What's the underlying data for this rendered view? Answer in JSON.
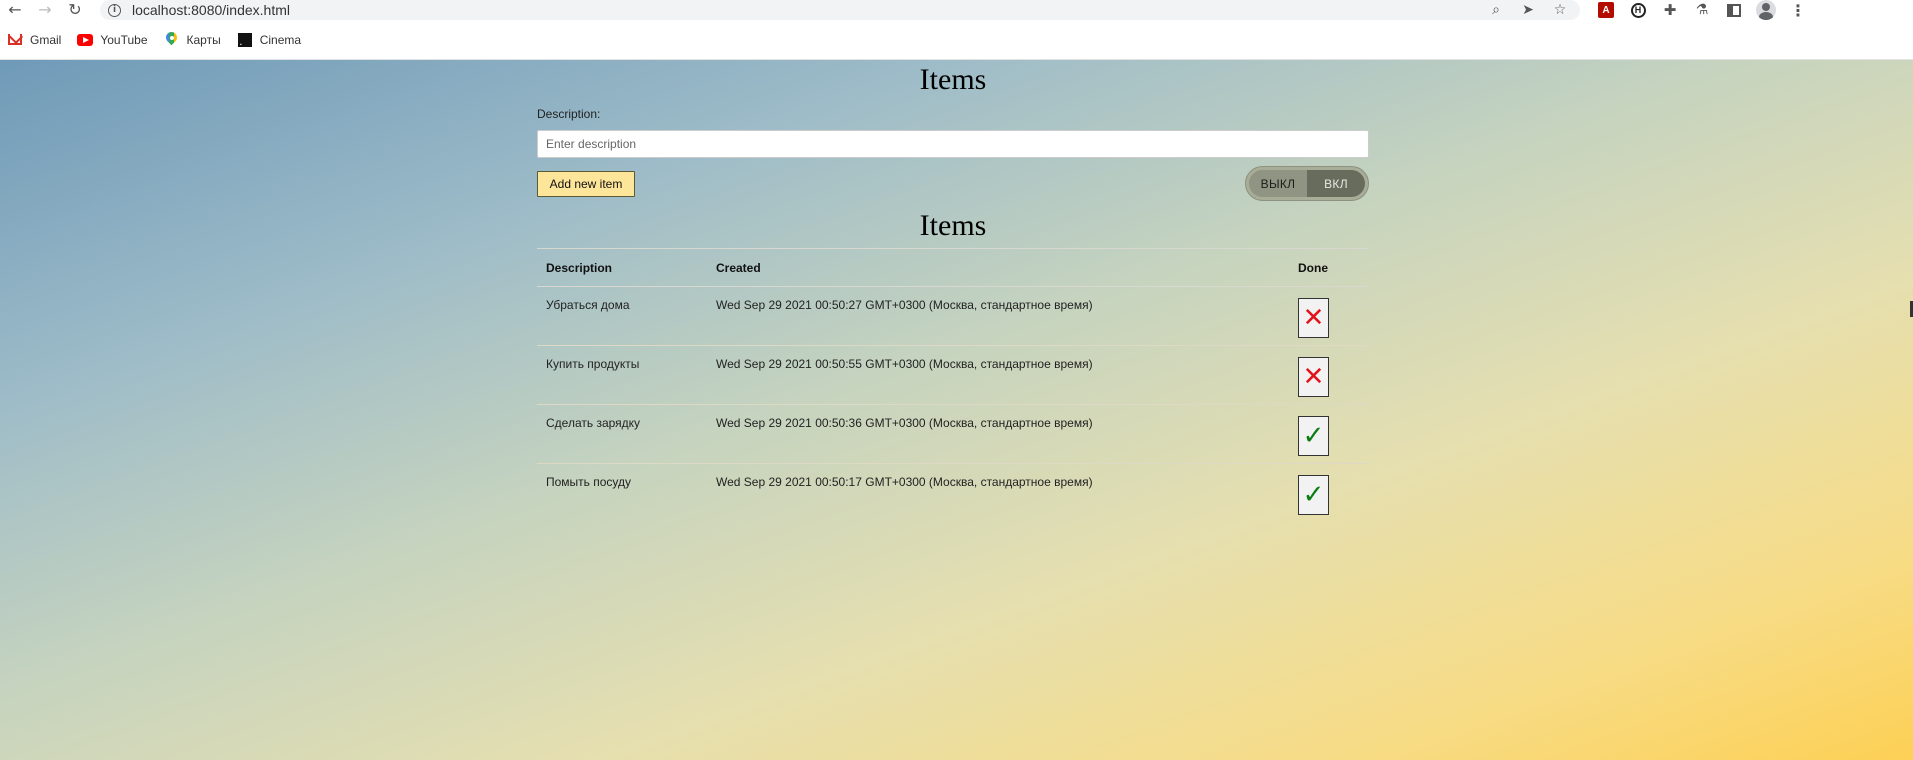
{
  "browser": {
    "url": "localhost:8080/index.html",
    "bookmarks": [
      {
        "label": "Gmail"
      },
      {
        "label": "YouTube"
      },
      {
        "label": "Карты"
      },
      {
        "label": "Cinema"
      }
    ]
  },
  "form": {
    "title": "Items",
    "description_label": "Description:",
    "description_placeholder": "Enter description",
    "description_value": "",
    "add_button_label": "Add new item",
    "toggle": {
      "off_label": "ВЫКЛ",
      "on_label": "ВКЛ",
      "state": "on"
    }
  },
  "list": {
    "title": "Items",
    "columns": {
      "description": "Description",
      "created": "Created",
      "done": "Done"
    },
    "rows": [
      {
        "description": "Убраться дома",
        "created": "Wed Sep 29 2021 00:50:27 GMT+0300 (Москва, стандартное время)",
        "done": false,
        "done_symbol": "✕"
      },
      {
        "description": "Купить продукты",
        "created": "Wed Sep 29 2021 00:50:55 GMT+0300 (Москва, стандартное время)",
        "done": false,
        "done_symbol": "✕"
      },
      {
        "description": "Сделать зарядку",
        "created": "Wed Sep 29 2021 00:50:36 GMT+0300 (Москва, стандартное время)",
        "done": true,
        "done_symbol": "✓"
      },
      {
        "description": "Помыть посуду",
        "created": "Wed Sep 29 2021 00:50:17 GMT+0300 (Москва, стандартное время)",
        "done": true,
        "done_symbol": "✓"
      }
    ]
  },
  "colors": {
    "add_button": "#fde59a",
    "not_done": "#e1131b",
    "done": "#0a7d12"
  }
}
